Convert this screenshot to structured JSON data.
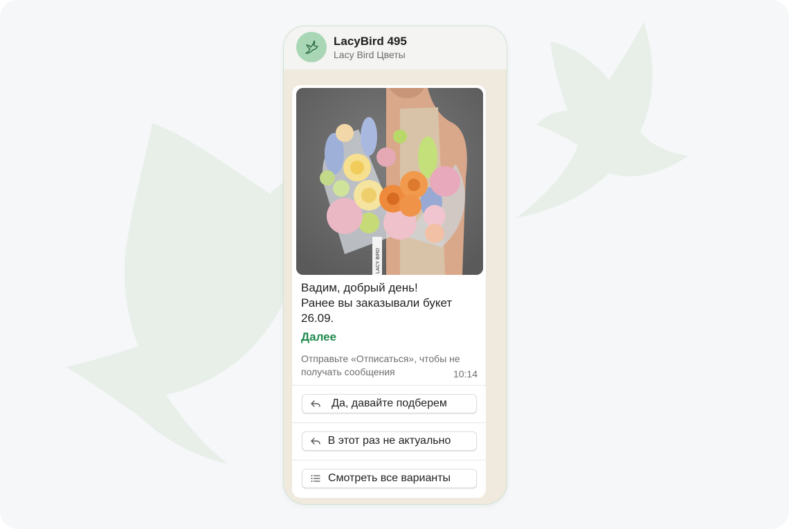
{
  "chat": {
    "contact_name": "LacyBird 495",
    "contact_subtitle": "Lacy Bird Цветы"
  },
  "message": {
    "text": "Вадим, добрый день!\nРанее вы заказывали букет 26.09.",
    "more_label": "Далее",
    "footer": "Отправьте «Отписаться», чтобы не получать сообщения",
    "time": "10:14",
    "ribbon_text": "LACY BIRD"
  },
  "buttons": [
    {
      "label": "Да, давайте подберем",
      "icon": "reply-icon"
    },
    {
      "label": "В этот раз не актуально",
      "icon": "reply-icon"
    },
    {
      "label": "Смотреть все варианты",
      "icon": "list-icon"
    }
  ],
  "colors": {
    "background": "#f5f7f9",
    "bird_shape": "#e8efe9",
    "avatar": "#a9d7b5",
    "link_green": "#1f8a4c",
    "chat_wallpaper": "#efe9de"
  }
}
